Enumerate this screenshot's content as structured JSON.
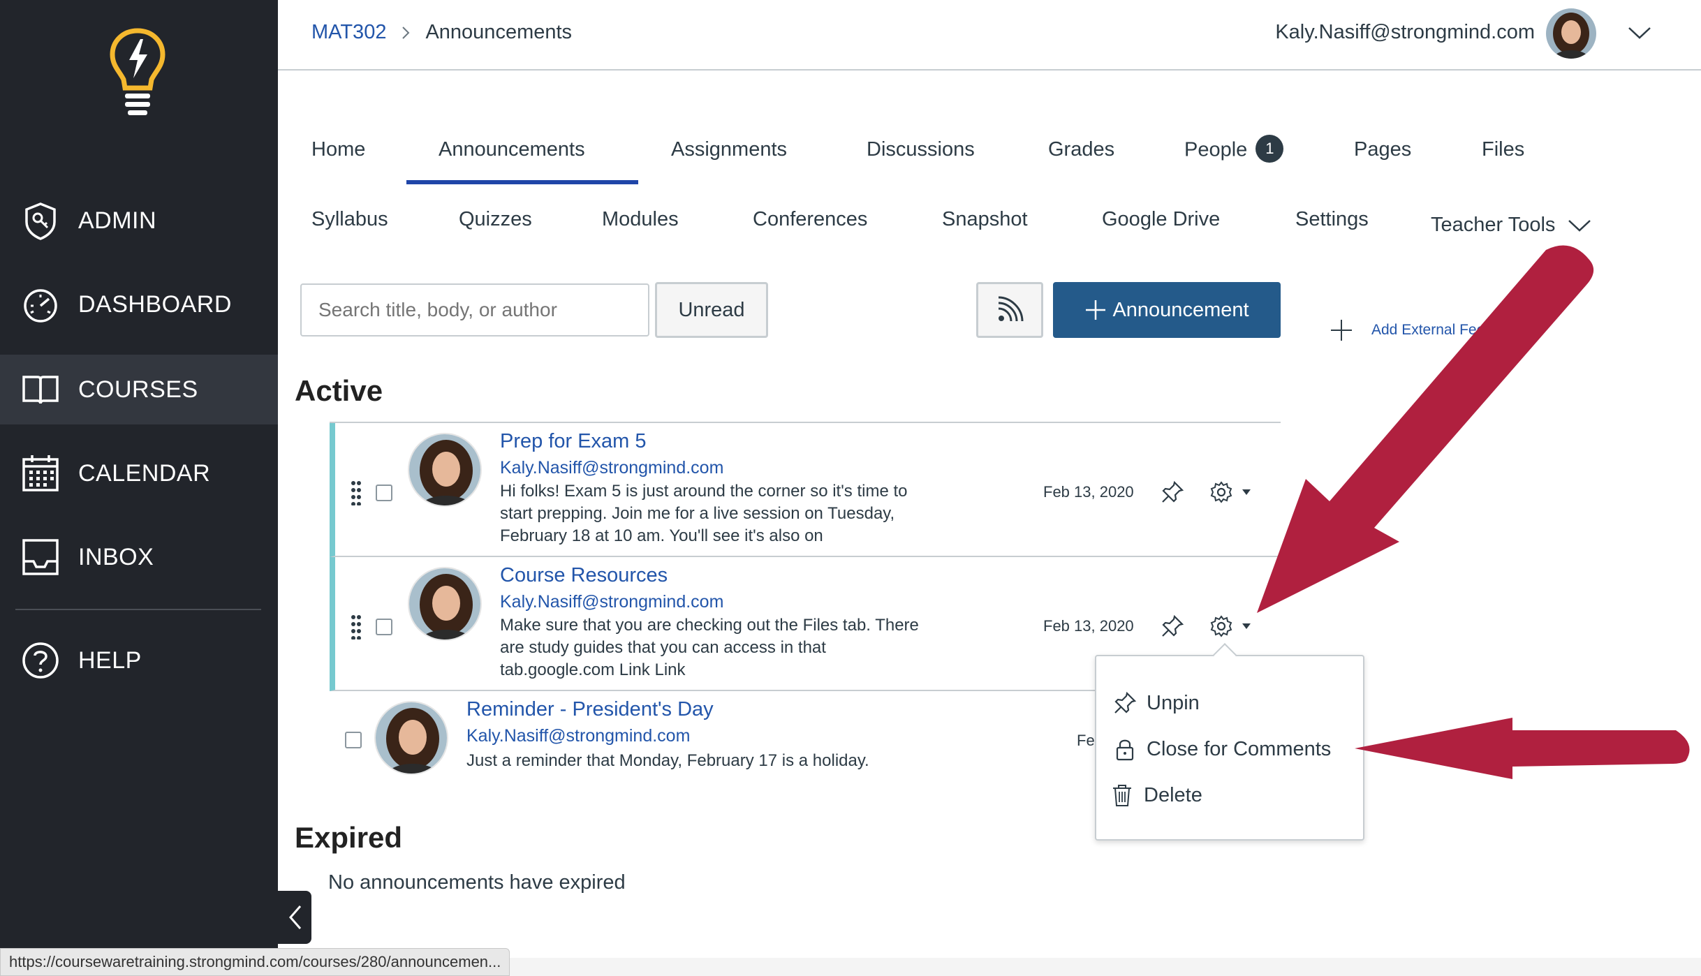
{
  "sidebar": {
    "items": [
      {
        "label": "ADMIN",
        "icon": "admin-shield-icon"
      },
      {
        "label": "DASHBOARD",
        "icon": "dashboard-gauge-icon"
      },
      {
        "label": "COURSES",
        "icon": "courses-book-icon"
      },
      {
        "label": "CALENDAR",
        "icon": "calendar-icon"
      },
      {
        "label": "INBOX",
        "icon": "inbox-tray-icon"
      },
      {
        "label": "HELP",
        "icon": "help-question-icon"
      }
    ]
  },
  "header": {
    "breadcrumb_course": "MAT302",
    "breadcrumb_page": "Announcements",
    "user_email": "Kaly.Nasiff@strongmind.com"
  },
  "tabs": {
    "row1": [
      "Home",
      "Announcements",
      "Assignments",
      "Discussions",
      "Grades",
      "People",
      "Pages",
      "Files"
    ],
    "row2": [
      "Syllabus",
      "Quizzes",
      "Modules",
      "Conferences",
      "Snapshot",
      "Google Drive",
      "Settings",
      "Teacher Tools"
    ],
    "people_badge": "1"
  },
  "toolbar": {
    "search_placeholder": "Search title, body, or author",
    "unread_label": "Unread",
    "add_label": "Announcement",
    "external_feed_label": "Add External Feed"
  },
  "sections": {
    "active": "Active",
    "expired": "Expired",
    "no_expired": "No announcements have expired"
  },
  "announcements": [
    {
      "title": "Prep for Exam 5",
      "author": "Kaly.Nasiff@strongmind.com",
      "body": "Hi folks! Exam 5 is just around the corner so it's time to start prepping. Join me for a live session on Tuesday, February 18 at 10 am. You'll see it's also on",
      "date": "Feb 13, 2020"
    },
    {
      "title": "Course Resources",
      "author": "Kaly.Nasiff@strongmind.com",
      "body": "Make sure that you are checking out the Files tab. There are study guides that you can access in that tab.google.com Link Link",
      "date": "Feb 13, 2020"
    },
    {
      "title": "Reminder - President's Day",
      "author": "Kaly.Nasiff@strongmind.com",
      "body": "Just a reminder that Monday, February 17 is a holiday.",
      "date": "Fe"
    }
  ],
  "menu": {
    "unpin": "Unpin",
    "close_comments": "Close for Comments",
    "delete": "Delete"
  },
  "status_bar_url": "https://coursewaretraining.strongmind.com/courses/280/announcemen...",
  "colors": {
    "sidebar_bg": "#22252b",
    "link_blue": "#2255aa",
    "primary_button": "#245a8a",
    "tab_underline": "#1f45a8",
    "pinned_accent": "#76c9cf",
    "annotation_arrow": "#b0203f",
    "logo_yellow": "#f5b82e"
  }
}
